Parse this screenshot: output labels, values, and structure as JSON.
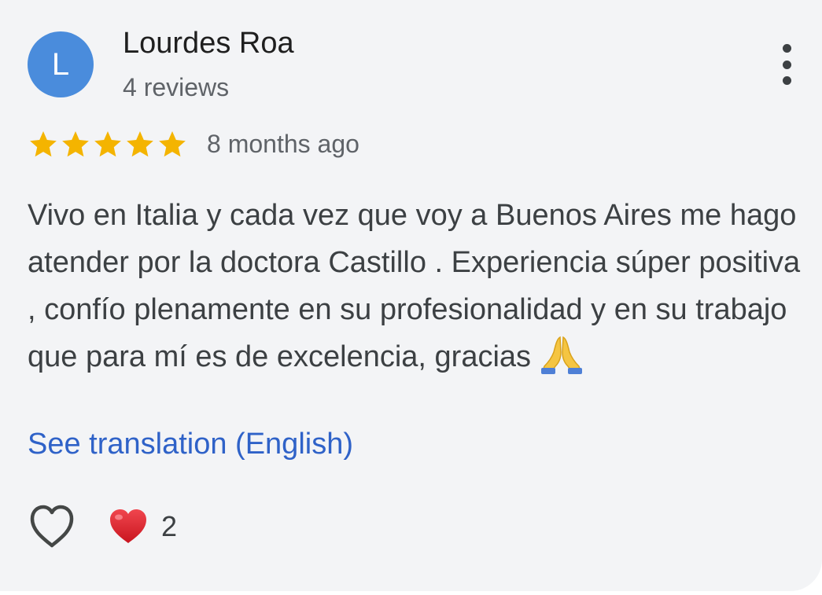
{
  "review": {
    "avatar_initial": "L",
    "author_name": "Lourdes Roa",
    "review_count": "4 reviews",
    "rating": 5,
    "rating_max": 5,
    "time_ago": "8 months ago",
    "text": "Vivo en Italia y cada vez que voy a Buenos Aires me hago atender por la doctora Castillo . Experiencia súper positiva , confío plenamente en su profesionalidad y en su trabajo que para mí es de excelencia, gracias",
    "text_emoji": "folded-hands-emoji",
    "translation_link": "See translation (English)",
    "reaction_count": "2"
  },
  "icons": {
    "more": "more-vert-icon",
    "like": "heart-outline-icon",
    "reaction": "red-heart-emoji"
  },
  "colors": {
    "avatar": "#4a8cdc",
    "star": "#f4b400",
    "link": "#2f62c8",
    "card_background": "#f3f4f6"
  }
}
